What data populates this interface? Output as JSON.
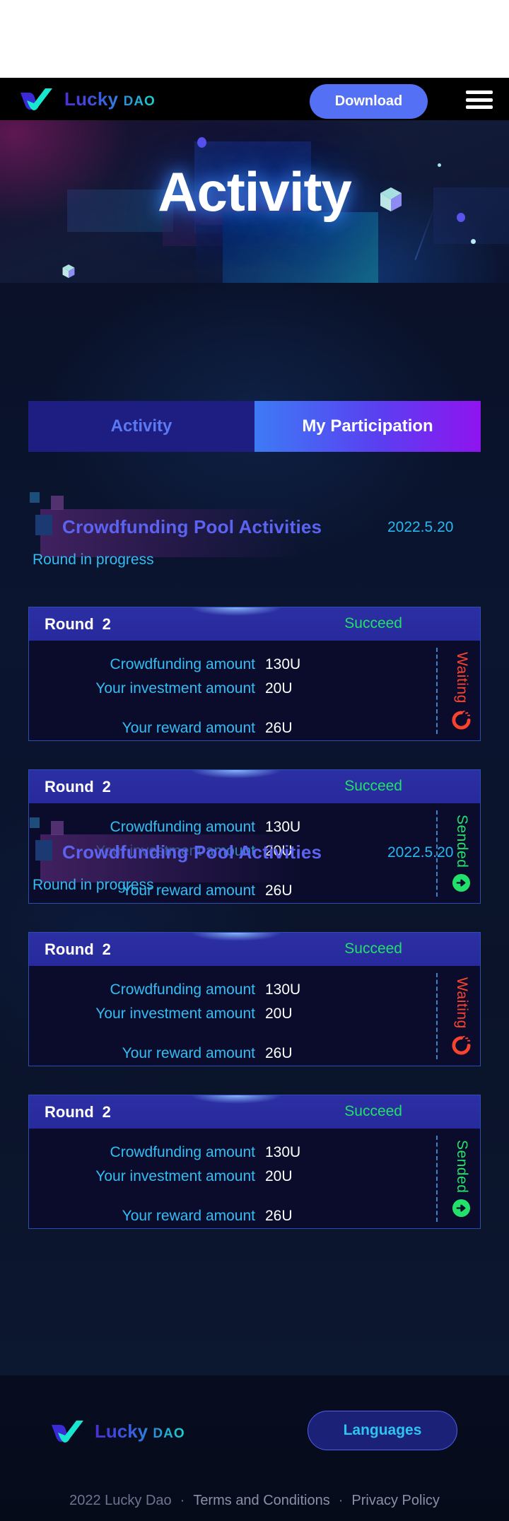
{
  "header": {
    "logo_name": "Lucky",
    "logo_suffix": "DAO",
    "download_label": "Download",
    "menu_icon": "hamburger-menu-icon"
  },
  "hero": {
    "title": "Activity"
  },
  "tabs": [
    {
      "label": "Activity",
      "active": false
    },
    {
      "label": "My Participation",
      "active": true
    }
  ],
  "sections": [
    {
      "title": "Crowdfunding Pool Activities",
      "date": "2022.5.20",
      "round_label": "Round in progress",
      "cards": [
        {
          "round_word": "Round",
          "round_number": "2",
          "status": "Succeed",
          "rows": [
            {
              "label": "Crowdfunding amount",
              "value": "130U"
            },
            {
              "label": "Your investment amount",
              "value": "20U"
            },
            {
              "label": "Your reward amount",
              "value": "26U"
            }
          ],
          "side_status": "Waiting",
          "side_state": "waiting",
          "side_icon": "spinner-icon"
        },
        {
          "round_word": "Round",
          "round_number": "2",
          "status": "Succeed",
          "rows": [
            {
              "label": "Crowdfunding amount",
              "value": "130U"
            },
            {
              "label": "Your investment amount",
              "value": "20U"
            },
            {
              "label": "Your reward amount",
              "value": "26U"
            }
          ],
          "side_status": "Sended",
          "side_state": "sended",
          "side_icon": "arrow-right-circle-icon"
        }
      ]
    },
    {
      "title": "Crowdfunding Pool Activities",
      "date": "2022.5.20",
      "round_label": "Round in progress",
      "cards": [
        {
          "round_word": "Round",
          "round_number": "2",
          "status": "Succeed",
          "rows": [
            {
              "label": "Crowdfunding amount",
              "value": "130U"
            },
            {
              "label": "Your investment amount",
              "value": "20U"
            },
            {
              "label": "Your reward amount",
              "value": "26U"
            }
          ],
          "side_status": "Waiting",
          "side_state": "waiting",
          "side_icon": "spinner-icon"
        },
        {
          "round_word": "Round",
          "round_number": "2",
          "status": "Succeed",
          "rows": [
            {
              "label": "Crowdfunding amount",
              "value": "130U"
            },
            {
              "label": "Your investment amount",
              "value": "20U"
            },
            {
              "label": "Your reward amount",
              "value": "26U"
            }
          ],
          "side_status": "Sended",
          "side_state": "sended",
          "side_icon": "arrow-right-circle-icon"
        }
      ]
    }
  ],
  "footer": {
    "logo_name": "Lucky",
    "logo_suffix": "DAO",
    "languages_label": "Languages",
    "copyright": "2022 Lucky Dao",
    "separator": "·",
    "terms_label": "Terms and Conditions",
    "privacy_label": "Privacy Policy"
  },
  "colors": {
    "accent_blue": "#34bdf2",
    "accent_purple": "#5b63f0",
    "success_green": "#22e06a",
    "warning_red": "#f8432e",
    "tab_active_start": "#3d7bf5",
    "tab_active_end": "#8f14ef",
    "download_bg": "#5470f5"
  }
}
